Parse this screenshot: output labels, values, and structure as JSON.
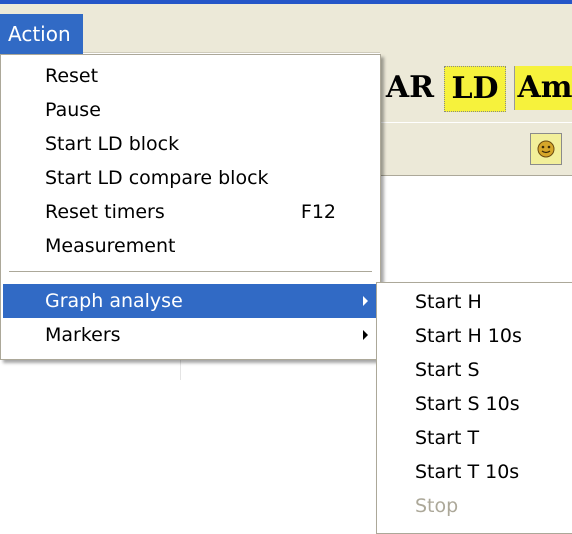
{
  "menubar": {
    "action_label": "Action"
  },
  "toolbar": {
    "ar_label": "AR",
    "ld_label": "LD",
    "am_label": "Am"
  },
  "action_menu": {
    "items": [
      {
        "label": "Reset"
      },
      {
        "label": "Pause"
      },
      {
        "label": "Start LD block"
      },
      {
        "label": "Start LD compare block"
      },
      {
        "label": "Reset timers",
        "shortcut": "F12"
      },
      {
        "label": "Measurement"
      },
      {
        "label": "Graph analyse",
        "has_submenu": true,
        "highlighted": true
      },
      {
        "label": "Markers",
        "has_submenu": true
      }
    ]
  },
  "graph_analyse_submenu": {
    "items": [
      {
        "label": "Start H"
      },
      {
        "label": "Start H 10s"
      },
      {
        "label": "Start S"
      },
      {
        "label": "Start S 10s"
      },
      {
        "label": "Start T"
      },
      {
        "label": "Start T 10s"
      },
      {
        "label": "Stop",
        "disabled": true
      }
    ]
  },
  "colors": {
    "highlight": "#316ac5",
    "toolbar_yellow": "#f6f23c",
    "disabled_text": "#aca899"
  },
  "icons": {
    "toolbar_small": "smiley-icon",
    "submenu_arrow": "triangle-right-icon"
  }
}
